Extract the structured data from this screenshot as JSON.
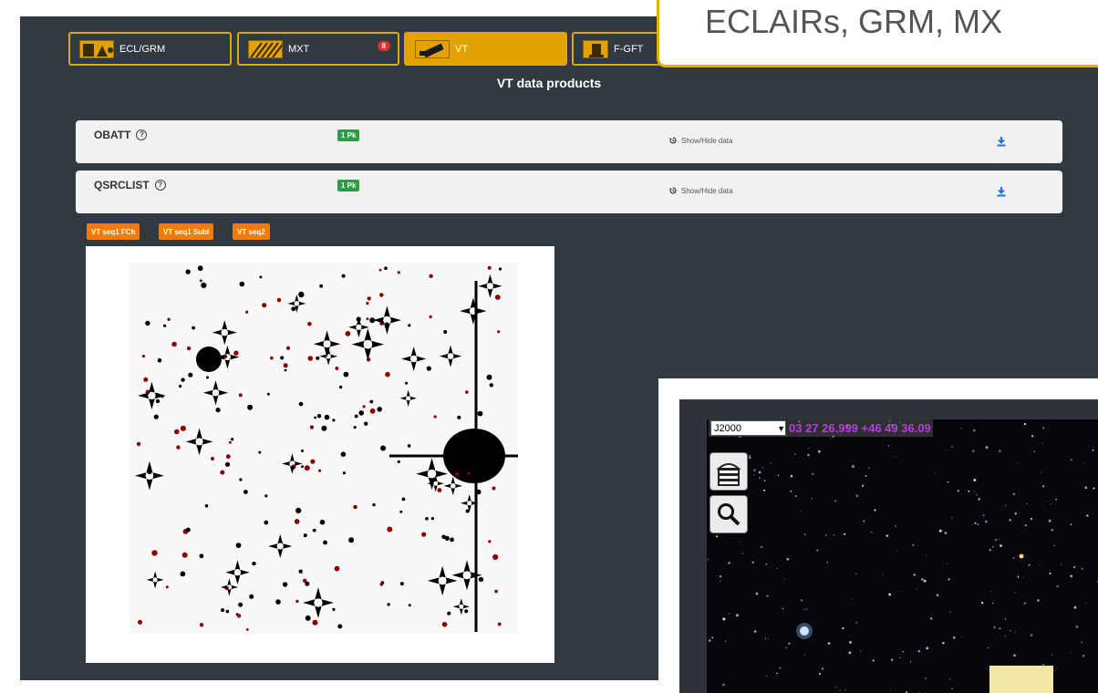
{
  "tabs": [
    {
      "label": "ECL/GRM",
      "icon": "instrument-ecl-grm-icon"
    },
    {
      "label": "MXT",
      "icon": "instrument-mxt-icon",
      "badge": "8"
    },
    {
      "label": "VT",
      "icon": "instrument-vt-icon",
      "active": true
    },
    {
      "label": "F-GFT",
      "icon": "instrument-fgft-icon"
    }
  ],
  "callout": {
    "text": "ECLAIRs, GRM, MX"
  },
  "section_title": "VT data products",
  "products": [
    {
      "name": "OBATT",
      "badge": "1 Pk",
      "action": "Show/Hide data"
    },
    {
      "name": "QSRCLIST",
      "badge": "1 Pk",
      "action": "Show/Hide data"
    }
  ],
  "sequence_buttons": [
    "VT seq1 FCh",
    "VT seq1 Subl",
    "VT seq2"
  ],
  "sky_viewer": {
    "frame": "J2000",
    "coordinates": "03 27 26.999 +46 49 36.09"
  },
  "colors": {
    "panel": "#323a41",
    "tab_accent": "#e3a200",
    "badge_green": "#2e9c46",
    "seq_orange": "#f57c00",
    "download_blue": "#1a73e8",
    "coord_magenta": "#b83ddb"
  }
}
